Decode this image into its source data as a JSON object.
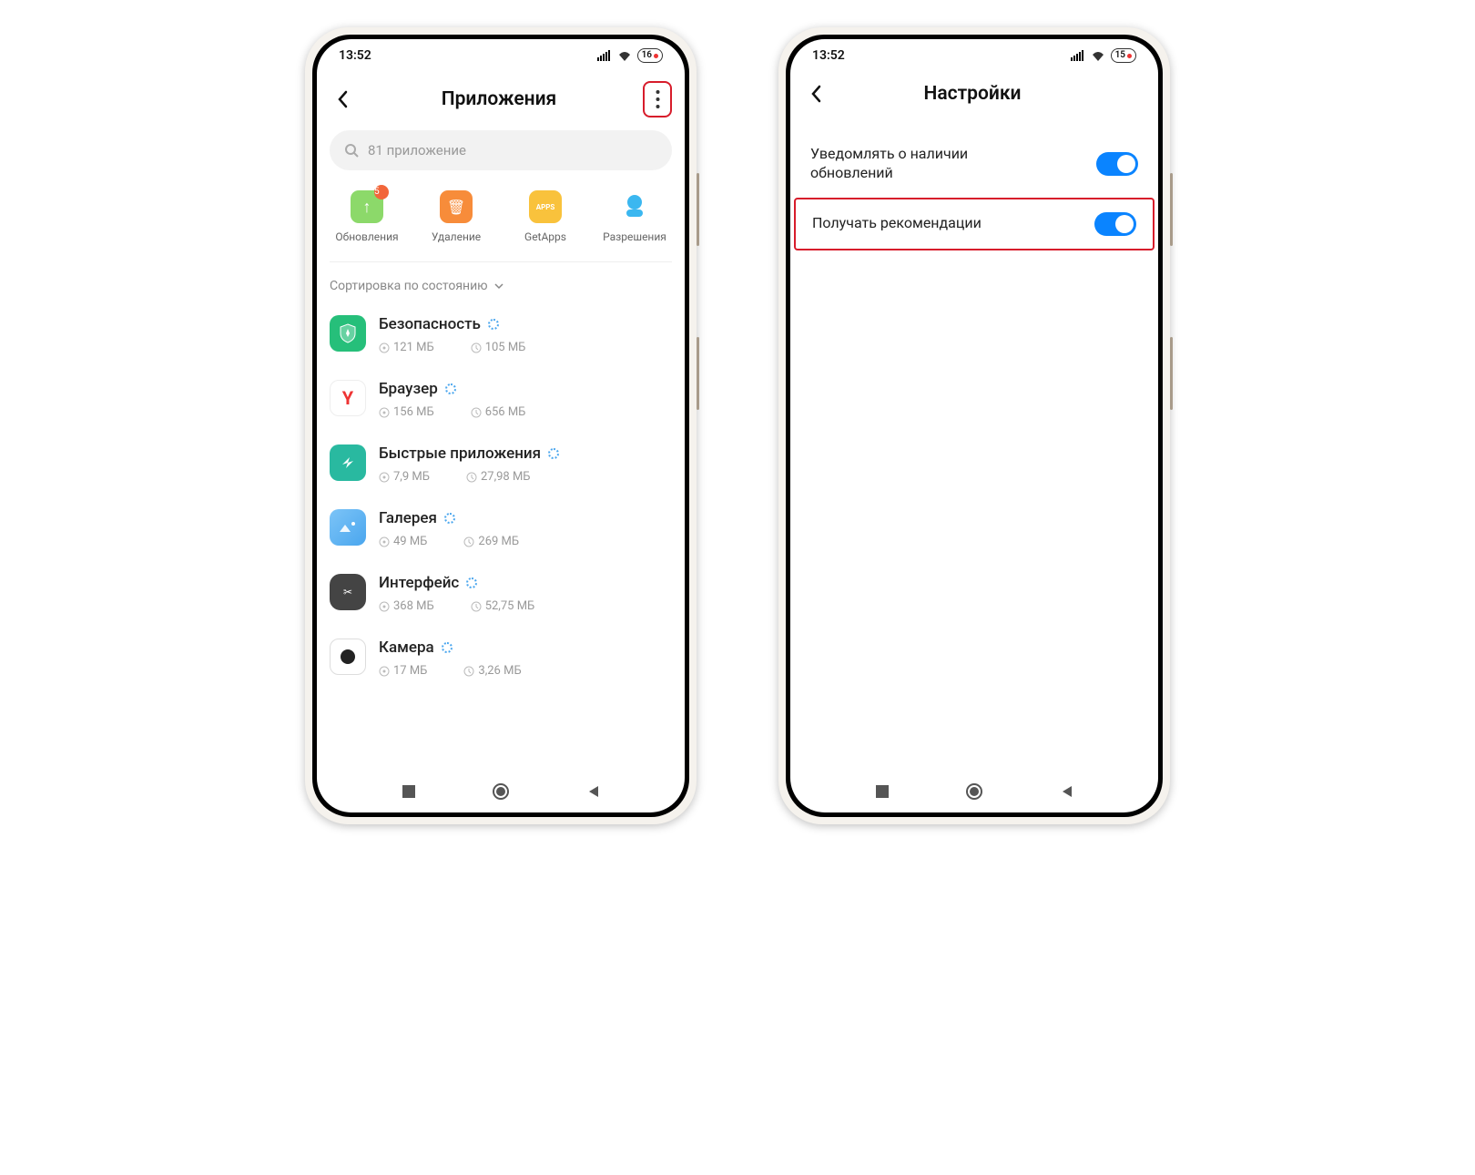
{
  "phone1": {
    "status": {
      "time": "13:52",
      "battery": "16"
    },
    "header": {
      "title": "Приложения"
    },
    "search": {
      "placeholder": "81 приложение"
    },
    "actions": {
      "updates": {
        "label": "Обновления",
        "badge": "5"
      },
      "delete": {
        "label": "Удаление"
      },
      "getapps": {
        "label": "GetApps"
      },
      "perms": {
        "label": "Разрешения"
      }
    },
    "sort": {
      "label": "Сортировка по состоянию"
    },
    "apps": [
      {
        "name": "Безопасность",
        "storage": "121 МБ",
        "time": "105 МБ"
      },
      {
        "name": "Браузер",
        "storage": "156 МБ",
        "time": "656 МБ"
      },
      {
        "name": "Быстрые приложения",
        "storage": "7,9 МБ",
        "time": "27,98 МБ"
      },
      {
        "name": "Галерея",
        "storage": "49 МБ",
        "time": "269 МБ"
      },
      {
        "name": "Интерфейс",
        "storage": "368 МБ",
        "time": "52,75 МБ"
      },
      {
        "name": "Камера",
        "storage": "17 МБ",
        "time": "3,26 МБ"
      }
    ]
  },
  "phone2": {
    "status": {
      "time": "13:52",
      "battery": "15"
    },
    "header": {
      "title": "Настройки"
    },
    "settings": [
      {
        "label": "Уведомлять о наличии обновлений",
        "on": true
      },
      {
        "label": "Получать рекомендации",
        "on": true
      }
    ]
  }
}
